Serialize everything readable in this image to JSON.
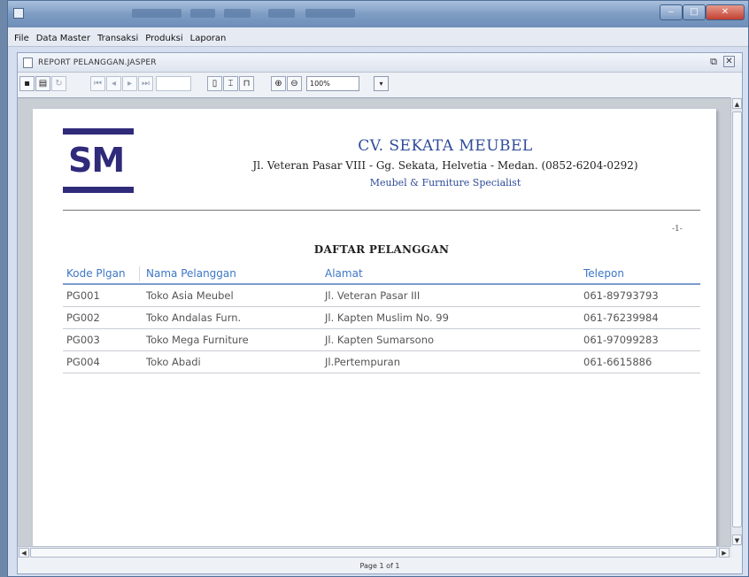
{
  "menu": [
    "File",
    "Data Master",
    "Transaksi",
    "Produksi",
    "Laporan"
  ],
  "frame_title": "REPORT PELANGGAN.JASPER",
  "zoom": "100%",
  "company": {
    "logo_text": "SM",
    "name": "CV. SEKATA MEUBEL",
    "address": "Jl. Veteran Pasar VIII - Gg. Sekata, Helvetia - Medan. (0852-6204-0292)",
    "tagline": "Meubel & Furniture Specialist"
  },
  "page_number": "-1-",
  "report_title": "DAFTAR PELANGGAN",
  "table": {
    "headers": [
      "Kode Plgan",
      "Nama Pelanggan",
      "Alamat",
      "Telepon"
    ],
    "rows": [
      [
        "PG001",
        "Toko Asia Meubel",
        "Jl. Veteran Pasar III",
        "061-89793793"
      ],
      [
        "PG002",
        "Toko Andalas Furn.",
        "Jl. Kapten Muslim No. 99",
        "061-76239984"
      ],
      [
        "PG003",
        "Toko Mega Furniture",
        "Jl. Kapten Sumarsono",
        "061-97099283"
      ],
      [
        "PG004",
        "Toko Abadi",
        "Jl.Pertempuran",
        "061-6615886"
      ]
    ]
  },
  "status": "Page 1 of 1",
  "colors": {
    "logo": "#2f2a7a",
    "company": "#2e4b9a",
    "header": "#3d76c7"
  }
}
